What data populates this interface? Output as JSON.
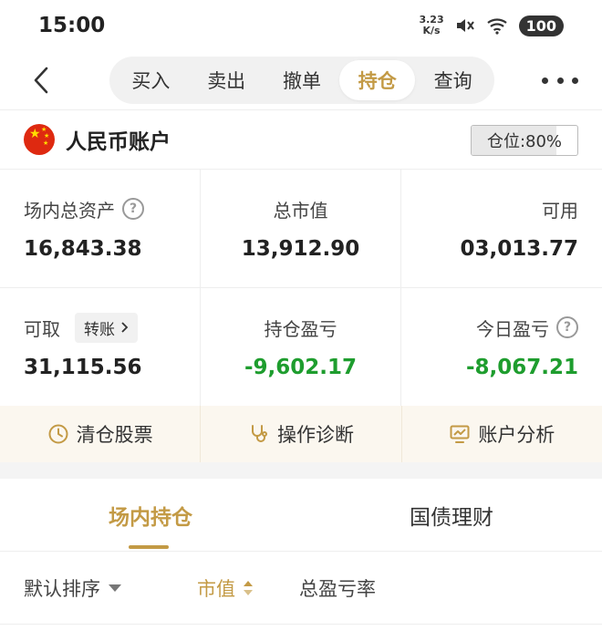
{
  "status_bar": {
    "time": "15:00",
    "net_speed_value": "3.23",
    "net_speed_unit": "K/s",
    "battery": "100"
  },
  "nav": {
    "tabs": [
      {
        "label": "买入"
      },
      {
        "label": "卖出"
      },
      {
        "label": "撤单"
      },
      {
        "label": "持仓"
      },
      {
        "label": "查询"
      }
    ],
    "active_tab": "持仓"
  },
  "account": {
    "name": "人民币账户",
    "position_label": "仓位:80%",
    "position_ratio": 0.8
  },
  "summary": {
    "total_assets_label": "场内总资产",
    "total_assets_value": "16,843.38",
    "market_value_label": "总市值",
    "market_value_value": "13,912.90",
    "available_label": "可用",
    "available_value": "03,013.77",
    "withdrawable_label": "可取",
    "transfer_label": "转账",
    "withdrawable_value": "31,115.56",
    "position_pnl_label": "持仓盈亏",
    "position_pnl_value": "-9,602.17",
    "today_pnl_label": "今日盈亏",
    "today_pnl_value": "-8,067.21"
  },
  "actions": {
    "clear": "清仓股票",
    "diagnose": "操作诊断",
    "analysis": "账户分析"
  },
  "sub_tabs": {
    "onsite": "场内持仓",
    "bonds": "国债理财"
  },
  "sort": {
    "default": "默认排序",
    "market_value": "市值",
    "total_pnl_rate": "总盈亏率"
  },
  "colors": {
    "accent": "#c39a45",
    "loss": "#1e9d2e"
  }
}
